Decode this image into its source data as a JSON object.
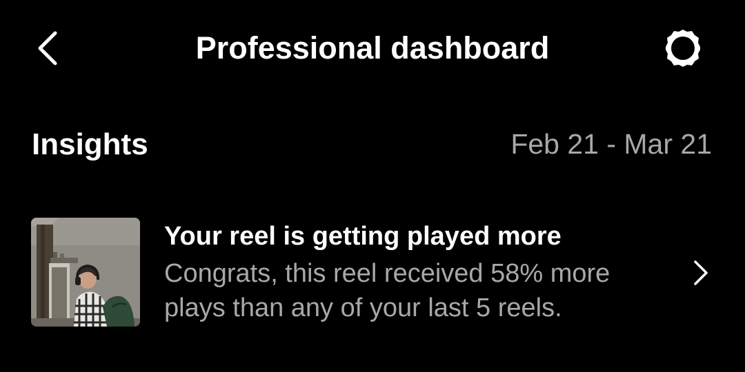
{
  "header": {
    "back_icon": "chevron-left-icon",
    "title": "Professional dashboard",
    "settings_icon": "gear-icon"
  },
  "insights": {
    "title": "Insights",
    "date_range": "Feb 21 - Mar 21"
  },
  "insight_card": {
    "thumbnail": "reel-thumbnail",
    "title": "Your reel is getting played more",
    "body": "Congrats, this reel received 58% more plays than any of your last 5 reels.",
    "chevron_icon": "chevron-right-icon"
  },
  "colors": {
    "background": "#000000",
    "primary_text": "#ffffff",
    "secondary_text": "#a8a8a8"
  }
}
